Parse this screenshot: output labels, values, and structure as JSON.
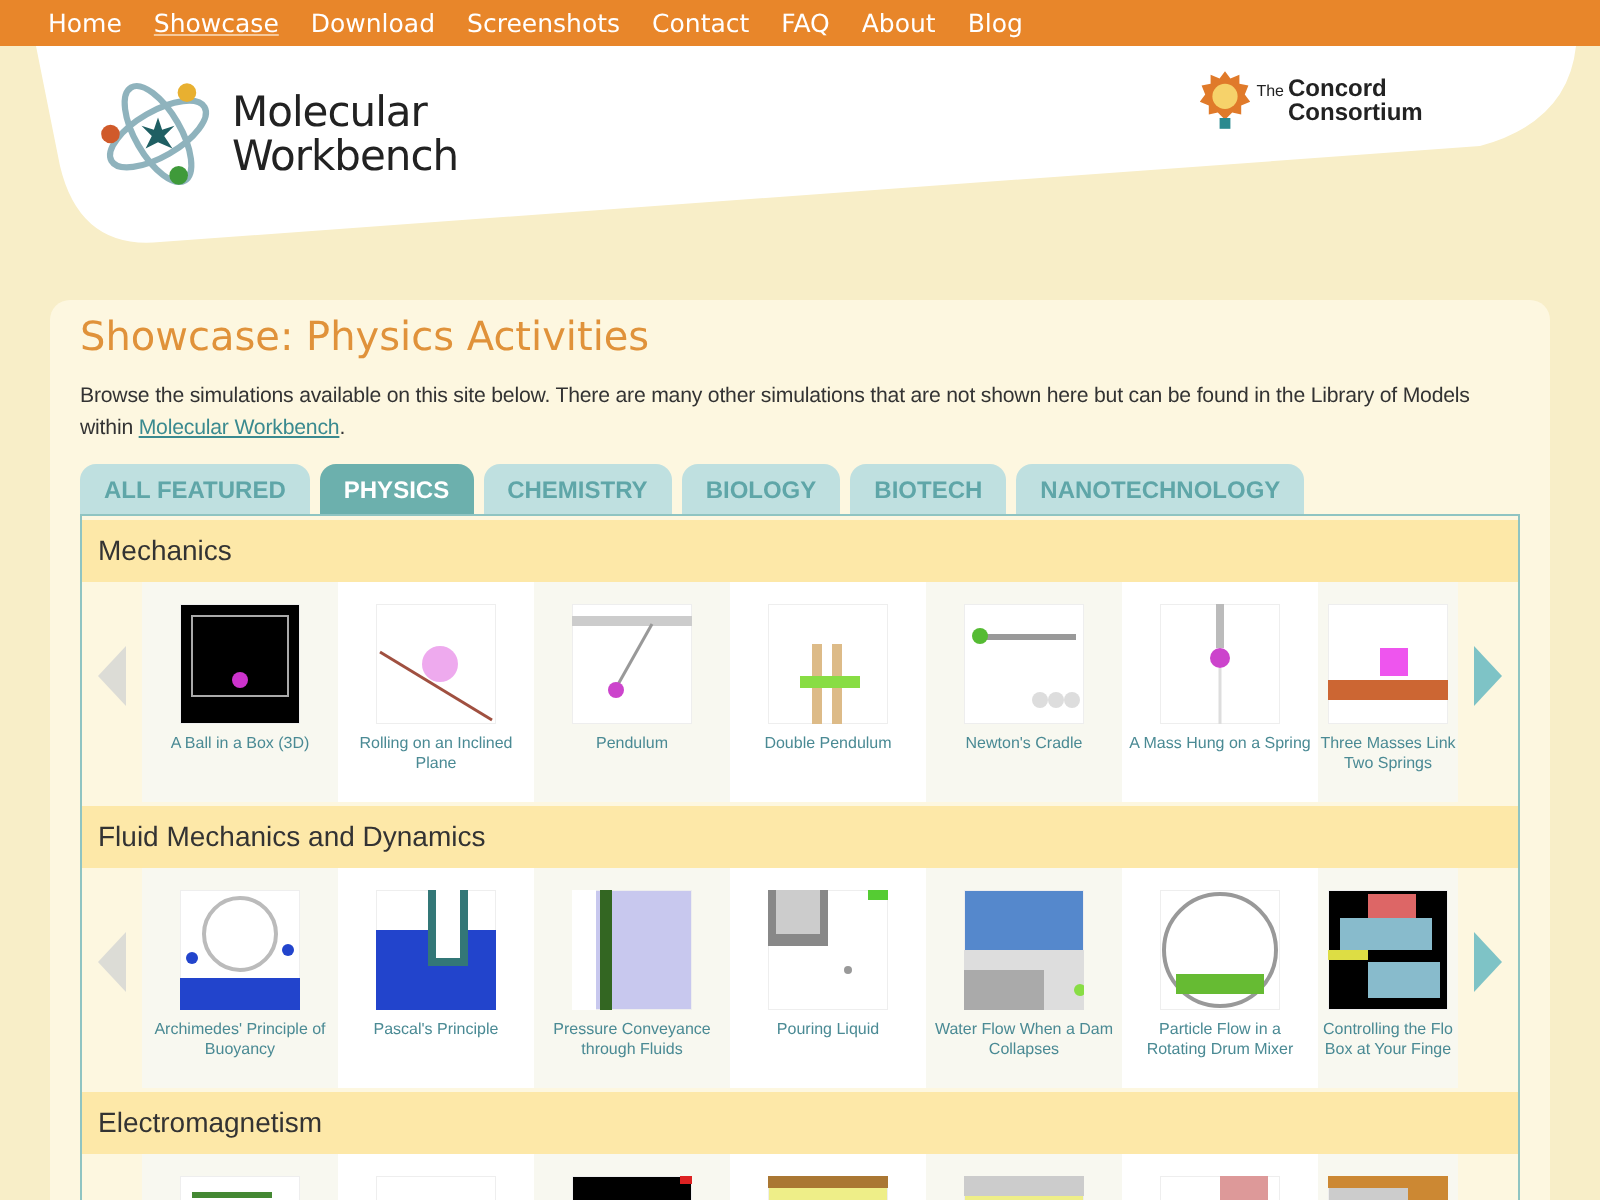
{
  "nav": [
    {
      "label": "Home",
      "selected": false
    },
    {
      "label": "Showcase",
      "selected": true
    },
    {
      "label": "Download",
      "selected": false
    },
    {
      "label": "Screenshots",
      "selected": false
    },
    {
      "label": "Contact",
      "selected": false
    },
    {
      "label": "FAQ",
      "selected": false
    },
    {
      "label": "About",
      "selected": false
    },
    {
      "label": "Blog",
      "selected": false
    }
  ],
  "logo": {
    "name": "Molecular Workbench"
  },
  "partner": {
    "prefix": "The",
    "name": "Concord Consortium"
  },
  "page": {
    "title": "Showcase: Physics Activities",
    "intro": "Browse the simulations available on this site below. There are many other simulations that are not shown here but can be found in the Library of Models within ",
    "link": "Molecular Workbench",
    "intro_end": "."
  },
  "tabs": [
    {
      "label": "ALL FEATURED",
      "selected": false
    },
    {
      "label": "PHYSICS",
      "selected": true
    },
    {
      "label": "CHEMISTRY",
      "selected": false
    },
    {
      "label": "BIOLOGY",
      "selected": false
    },
    {
      "label": "BIOTECH",
      "selected": false
    },
    {
      "label": "NANOTECHNOLOGY",
      "selected": false
    }
  ],
  "sections": [
    {
      "title": "Mechanics",
      "prev_enabled": false,
      "next_enabled": true,
      "items": [
        {
          "caption": [
            "A Ball in a Box (3D)"
          ]
        },
        {
          "caption": [
            "Rolling on an Inclined",
            "Plane"
          ]
        },
        {
          "caption": [
            "Pendulum"
          ]
        },
        {
          "caption": [
            "Double Pendulum"
          ]
        },
        {
          "caption": [
            "Newton's Cradle"
          ]
        },
        {
          "caption": [
            "A Mass Hung on a Spring"
          ]
        },
        {
          "caption": [
            "Three Masses Link",
            "Two Springs"
          ]
        }
      ]
    },
    {
      "title": "Fluid Mechanics and Dynamics",
      "prev_enabled": false,
      "next_enabled": true,
      "items": [
        {
          "caption": [
            "Archimedes' Principle of",
            "Buoyancy"
          ]
        },
        {
          "caption": [
            "Pascal's Principle"
          ]
        },
        {
          "caption": [
            "Pressure Conveyance",
            "through Fluids"
          ]
        },
        {
          "caption": [
            "Pouring Liquid"
          ]
        },
        {
          "caption": [
            "Water Flow When a Dam",
            "Collapses"
          ]
        },
        {
          "caption": [
            "Particle Flow in a",
            "Rotating Drum Mixer"
          ]
        },
        {
          "caption": [
            "Controlling the Flo",
            "Box at Your Finge"
          ]
        }
      ]
    },
    {
      "title": "Electromagnetism"
    }
  ]
}
